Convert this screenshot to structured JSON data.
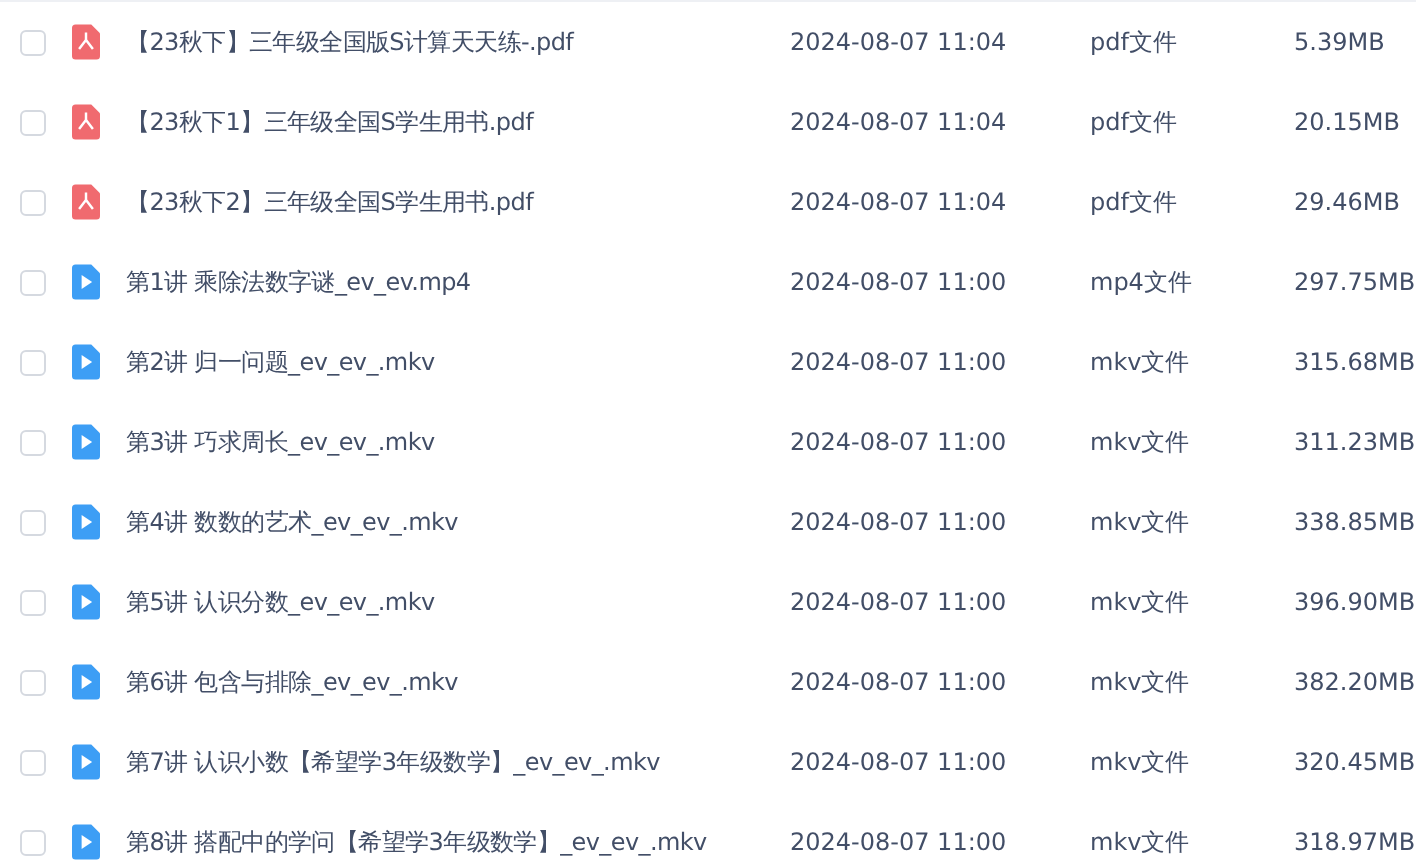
{
  "files": [
    {
      "kind": "pdf",
      "checked": false,
      "name": "【23秋下】三年级全国版S计算天天练-.pdf",
      "modified": "2024-08-07 11:04",
      "type": "pdf文件",
      "size": "5.39MB"
    },
    {
      "kind": "pdf",
      "checked": false,
      "name": "【23秋下1】三年级全国S学生用书.pdf",
      "modified": "2024-08-07 11:04",
      "type": "pdf文件",
      "size": "20.15MB"
    },
    {
      "kind": "pdf",
      "checked": false,
      "name": "【23秋下2】三年级全国S学生用书.pdf",
      "modified": "2024-08-07 11:04",
      "type": "pdf文件",
      "size": "29.46MB"
    },
    {
      "kind": "video",
      "checked": false,
      "name": "第1讲 乘除法数字谜_ev_ev.mp4",
      "modified": "2024-08-07 11:00",
      "type": "mp4文件",
      "size": "297.75MB"
    },
    {
      "kind": "video",
      "checked": false,
      "name": "第2讲 归一问题_ev_ev_.mkv",
      "modified": "2024-08-07 11:00",
      "type": "mkv文件",
      "size": "315.68MB"
    },
    {
      "kind": "video",
      "checked": false,
      "name": "第3讲 巧求周长_ev_ev_.mkv",
      "modified": "2024-08-07 11:00",
      "type": "mkv文件",
      "size": "311.23MB"
    },
    {
      "kind": "video",
      "checked": false,
      "name": "第4讲 数数的艺术_ev_ev_.mkv",
      "modified": "2024-08-07 11:00",
      "type": "mkv文件",
      "size": "338.85MB"
    },
    {
      "kind": "video",
      "checked": false,
      "name": "第5讲 认识分数_ev_ev_.mkv",
      "modified": "2024-08-07 11:00",
      "type": "mkv文件",
      "size": "396.90MB"
    },
    {
      "kind": "video",
      "checked": false,
      "name": "第6讲 包含与排除_ev_ev_.mkv",
      "modified": "2024-08-07 11:00",
      "type": "mkv文件",
      "size": "382.20MB"
    },
    {
      "kind": "video",
      "checked": false,
      "name": "第7讲 认识小数【希望学3年级数学】_ev_ev_.mkv",
      "modified": "2024-08-07 11:00",
      "type": "mkv文件",
      "size": "320.45MB"
    },
    {
      "kind": "video",
      "checked": false,
      "name": "第8讲 搭配中的学问【希望学3年级数学】_ev_ev_.mkv",
      "modified": "2024-08-07 11:00",
      "type": "mkv文件",
      "size": "318.97MB"
    }
  ]
}
